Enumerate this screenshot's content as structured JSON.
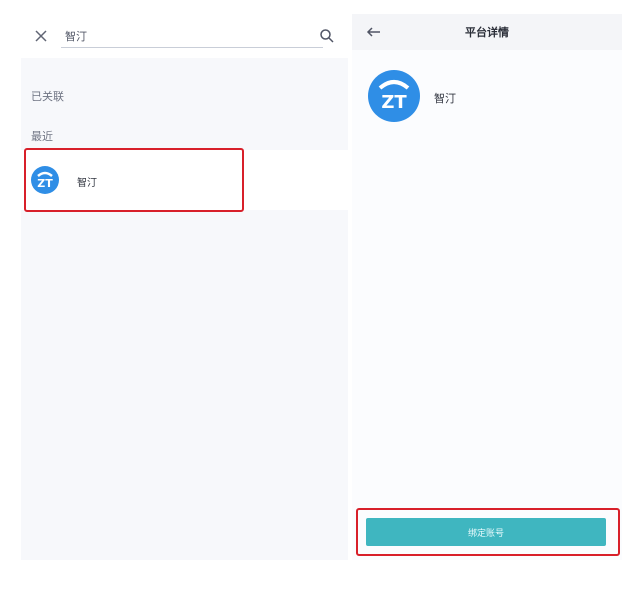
{
  "search": {
    "value": "智汀"
  },
  "sections": {
    "followed": "已关联",
    "recent": "最近"
  },
  "results": [
    {
      "label": "智汀",
      "icon": "zhiting-logo-icon"
    }
  ],
  "detail": {
    "title": "平台详情",
    "platform_name": "智汀",
    "bind_button": "绑定账号"
  },
  "colors": {
    "accent": "#3fb6c0",
    "logo_blue": "#2f8ee6",
    "highlight_red": "#d8202a"
  }
}
